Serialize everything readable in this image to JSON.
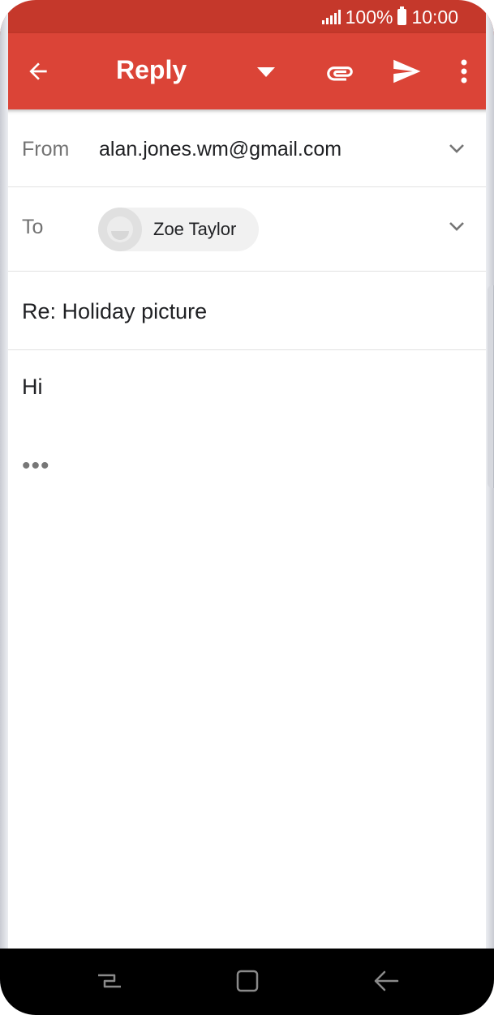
{
  "status_bar": {
    "battery_percent": "100%",
    "time": "10:00",
    "icons": [
      "signal-icon",
      "battery-icon"
    ]
  },
  "app_bar": {
    "title": "Reply",
    "icons": [
      "back-arrow-icon",
      "dropdown-arrow-icon",
      "paperclip-icon",
      "send-icon",
      "more-vert-icon"
    ],
    "background": "#db4437",
    "status_background": "#c5382b"
  },
  "compose": {
    "from_label": "From",
    "from_value": "alan.jones.wm@gmail.com",
    "to_label": "To",
    "to_recipient": "Zoe Taylor",
    "subject": "Re: Holiday picture",
    "body": "Hi",
    "quoted_toggle": "•••"
  },
  "nav_bar": {
    "icons": [
      "recent-apps-icon",
      "home-icon",
      "nav-back-icon"
    ]
  }
}
